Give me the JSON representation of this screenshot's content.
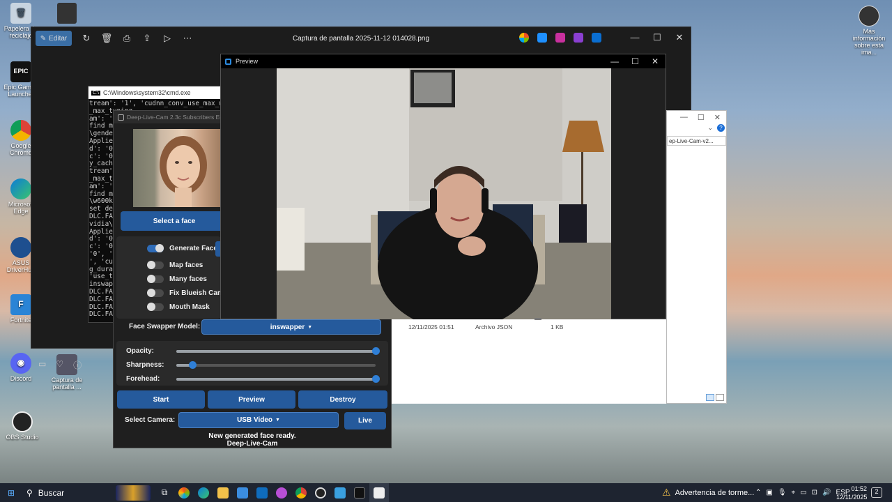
{
  "desktop": {
    "icons": [
      {
        "label": "Papelera de reciclaje",
        "icon": "recycle-bin-icon"
      },
      {
        "label": "Epic Games Launcher",
        "icon": "epic-games-icon"
      },
      {
        "label": "Google Chrome",
        "icon": "chrome-icon"
      },
      {
        "label": "Microsoft Edge",
        "icon": "edge-icon"
      },
      {
        "label": "ASUS DriverHub",
        "icon": "asus-icon"
      },
      {
        "label": "Fortnite",
        "icon": "fortnite-icon"
      },
      {
        "label": "Discord",
        "icon": "discord-icon"
      },
      {
        "label": "Captura de pantalla ...",
        "icon": "screenshot-file-icon"
      },
      {
        "label": "OBS Studio",
        "icon": "obs-icon"
      },
      {
        "label": "Más información sobre esta ima...",
        "icon": "info-camera-icon"
      }
    ]
  },
  "photos_app": {
    "edit_label": "Editar",
    "title": "Captura de pantalla 2025-11-12 014028.png"
  },
  "cmd": {
    "title": "C:\\Windows\\system32\\cmd.exe",
    "lines": [
      "tream': '1', 'cudnn_conv_use_max_wor",
      "_max_tuning_",
      "am': 'e",
      "find mo",
      "\\gender",
      "Applied",
      "d': '0",
      "c': '0",
      "y_cache",
      "tream':",
      "_max_tu",
      "am': 'e",
      "find mo",
      "\\w600k_",
      "set det",
      "DLC.FAC",
      "vidia\\r",
      "Applied",
      "d': '0",
      "c': '0",
      "'0', 'a",
      "', 'cud",
      "g_durat",
      "'use_tf",
      "inswapp",
      "DLC.FAC",
      "DLC.FAC",
      "DLC.FAC",
      "DLC.FAC",
      "_"
    ]
  },
  "dlc": {
    "title": "Deep-Live-Cam 2.3c Subscribers Edition",
    "select_face": "Select a face",
    "toggles": [
      {
        "label": "Generate Face",
        "on": true
      },
      {
        "label": "Map faces",
        "on": false
      },
      {
        "label": "Many faces",
        "on": false
      },
      {
        "label": "Fix Blueish Cam",
        "on": false
      },
      {
        "label": "Mouth Mask",
        "on": false
      }
    ],
    "model_label": "Face Swapper Model:",
    "model_value": "inswapper",
    "sliders": [
      {
        "label": "Opacity:",
        "value": 1.0
      },
      {
        "label": "Sharpness:",
        "value": 0.08
      },
      {
        "label": "Forehead:",
        "value": 1.0
      }
    ],
    "start": "Start",
    "preview": "Preview",
    "destroy": "Destroy",
    "camera_label": "Select Camera:",
    "camera_value": "USB Video",
    "live": "Live",
    "status_line1": "New generated face ready.",
    "status_line2": "Deep-Live-Cam"
  },
  "preview": {
    "title": "Preview"
  },
  "explorer": {
    "path": "ep-Live-Cam-v2...",
    "row_date": "12/11/2025 01:51",
    "row_type": "Archivo JSON",
    "row_size": "1 KB"
  },
  "taskbar": {
    "search": "Buscar",
    "weather": "Advertencia de torme...",
    "lang": "ESP",
    "time": "01:52",
    "date": "12/11/2025",
    "notif_count": "2"
  }
}
